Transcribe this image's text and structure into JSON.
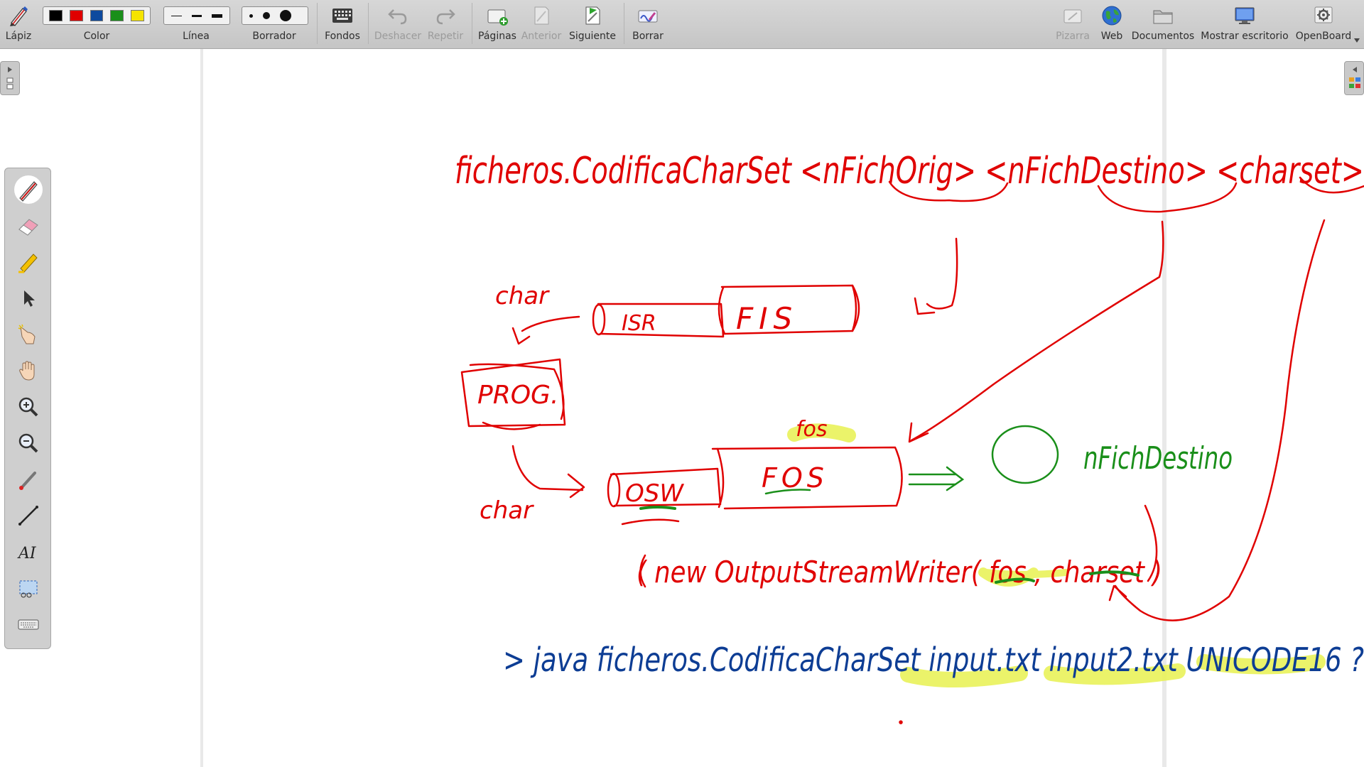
{
  "toolbar": {
    "pencil": "Lápiz",
    "color": "Color",
    "line": "Línea",
    "eraser": "Borrador",
    "backgrounds": "Fondos",
    "undo": "Deshacer",
    "redo": "Repetir",
    "pages": "Páginas",
    "previous": "Anterior",
    "next": "Siguiente",
    "clear": "Borrar",
    "board": "Pizarra",
    "web": "Web",
    "documents": "Documentos",
    "show_desktop": "Mostrar escritorio",
    "openboard": "OpenBoard"
  },
  "colors": {
    "black": "#000000",
    "red": "#e00000",
    "blue": "#0d4a9e",
    "green": "#1a8f1a",
    "yellow": "#f5e400"
  },
  "tools": [
    "pen-tool",
    "eraser-tool",
    "marker-tool",
    "selector-tool",
    "interact-tool",
    "hand-tool",
    "zoom-in-tool",
    "zoom-out-tool",
    "laser-pointer-tool",
    "line-tool",
    "text-tool",
    "capture-tool",
    "keyboard-tool"
  ],
  "ink": {
    "title": "ficheros.CodificaCharSet <nFichOrig> <nFichDestino> <charset>",
    "isr": "ISR",
    "fis": "FIS",
    "prog": "PROG.",
    "char_top": "char",
    "char_bottom": "char",
    "osw": "OSW",
    "fos": "FOS",
    "fos_small": "fos",
    "dest_label": "nFichDestino",
    "constructor": "( new OutputStreamWriter( fos , charset )",
    "command": "> java ficheros.CodificaCharSet input.txt input2.txt UNICODE16 ?"
  }
}
